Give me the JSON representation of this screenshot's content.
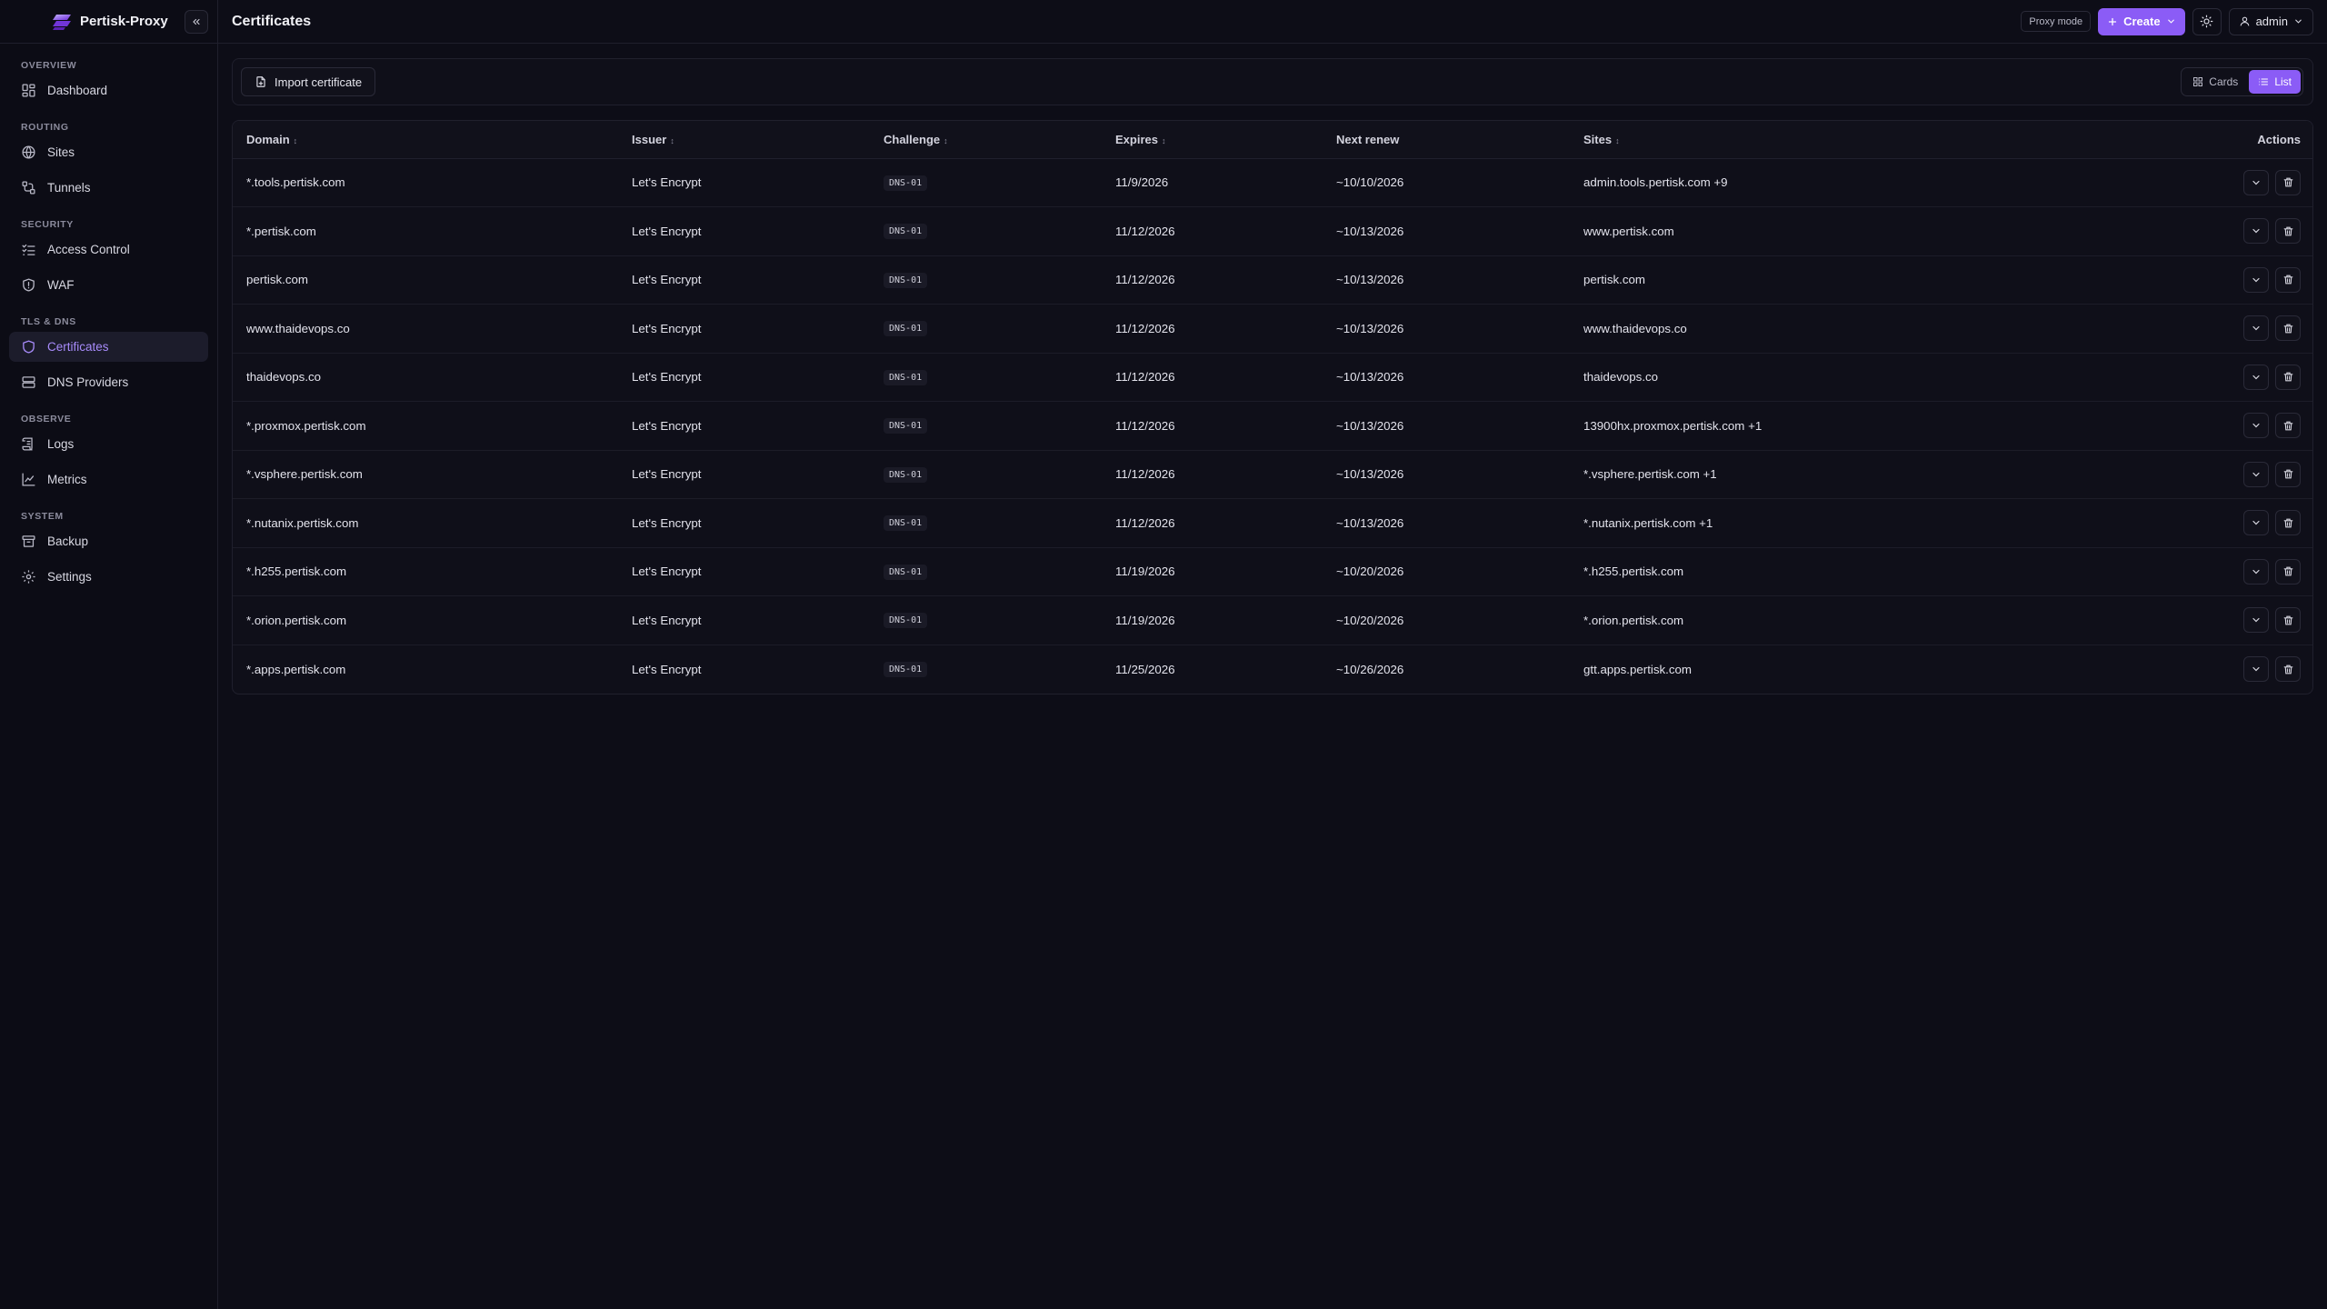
{
  "app": {
    "name": "Pertisk-Proxy"
  },
  "header": {
    "title": "Certificates",
    "proxy_mode": "Proxy mode",
    "create_label": "Create",
    "user": "admin"
  },
  "sidebar": {
    "sections": [
      {
        "title": "OVERVIEW",
        "items": [
          {
            "label": "Dashboard",
            "icon": "dashboard-icon"
          }
        ]
      },
      {
        "title": "ROUTING",
        "items": [
          {
            "label": "Sites",
            "icon": "globe-icon"
          },
          {
            "label": "Tunnels",
            "icon": "tunnel-icon"
          }
        ]
      },
      {
        "title": "SECURITY",
        "items": [
          {
            "label": "Access Control",
            "icon": "list-check-icon"
          },
          {
            "label": "WAF",
            "icon": "shield-alert-icon"
          }
        ]
      },
      {
        "title": "TLS & DNS",
        "items": [
          {
            "label": "Certificates",
            "icon": "shield-icon",
            "active": true
          },
          {
            "label": "DNS Providers",
            "icon": "server-icon"
          }
        ]
      },
      {
        "title": "OBSERVE",
        "items": [
          {
            "label": "Logs",
            "icon": "scroll-icon"
          },
          {
            "label": "Metrics",
            "icon": "chart-line-icon"
          }
        ]
      },
      {
        "title": "SYSTEM",
        "items": [
          {
            "label": "Backup",
            "icon": "archive-icon"
          },
          {
            "label": "Settings",
            "icon": "gear-icon"
          }
        ]
      }
    ]
  },
  "toolbar": {
    "import_label": "Import certificate",
    "view_cards": "Cards",
    "view_list": "List",
    "active_view": "List"
  },
  "table": {
    "columns": {
      "domain": "Domain",
      "issuer": "Issuer",
      "challenge": "Challenge",
      "expires": "Expires",
      "next_renew": "Next renew",
      "sites": "Sites",
      "actions": "Actions"
    },
    "rows": [
      {
        "domain": "*.tools.pertisk.com",
        "issuer": "Let's Encrypt",
        "challenge": "DNS-01",
        "expires": "11/9/2026",
        "next_renew": "~10/10/2026",
        "sites": "admin.tools.pertisk.com +9"
      },
      {
        "domain": "*.pertisk.com",
        "issuer": "Let's Encrypt",
        "challenge": "DNS-01",
        "expires": "11/12/2026",
        "next_renew": "~10/13/2026",
        "sites": "www.pertisk.com"
      },
      {
        "domain": "pertisk.com",
        "issuer": "Let's Encrypt",
        "challenge": "DNS-01",
        "expires": "11/12/2026",
        "next_renew": "~10/13/2026",
        "sites": "pertisk.com"
      },
      {
        "domain": "www.thaidevops.co",
        "issuer": "Let's Encrypt",
        "challenge": "DNS-01",
        "expires": "11/12/2026",
        "next_renew": "~10/13/2026",
        "sites": "www.thaidevops.co"
      },
      {
        "domain": "thaidevops.co",
        "issuer": "Let's Encrypt",
        "challenge": "DNS-01",
        "expires": "11/12/2026",
        "next_renew": "~10/13/2026",
        "sites": "thaidevops.co"
      },
      {
        "domain": "*.proxmox.pertisk.com",
        "issuer": "Let's Encrypt",
        "challenge": "DNS-01",
        "expires": "11/12/2026",
        "next_renew": "~10/13/2026",
        "sites": "13900hx.proxmox.pertisk.com +1"
      },
      {
        "domain": "*.vsphere.pertisk.com",
        "issuer": "Let's Encrypt",
        "challenge": "DNS-01",
        "expires": "11/12/2026",
        "next_renew": "~10/13/2026",
        "sites": "*.vsphere.pertisk.com +1"
      },
      {
        "domain": "*.nutanix.pertisk.com",
        "issuer": "Let's Encrypt",
        "challenge": "DNS-01",
        "expires": "11/12/2026",
        "next_renew": "~10/13/2026",
        "sites": "*.nutanix.pertisk.com +1"
      },
      {
        "domain": "*.h255.pertisk.com",
        "issuer": "Let's Encrypt",
        "challenge": "DNS-01",
        "expires": "11/19/2026",
        "next_renew": "~10/20/2026",
        "sites": "*.h255.pertisk.com"
      },
      {
        "domain": "*.orion.pertisk.com",
        "issuer": "Let's Encrypt",
        "challenge": "DNS-01",
        "expires": "11/19/2026",
        "next_renew": "~10/20/2026",
        "sites": "*.orion.pertisk.com"
      },
      {
        "domain": "*.apps.pertisk.com",
        "issuer": "Let's Encrypt",
        "challenge": "DNS-01",
        "expires": "11/25/2026",
        "next_renew": "~10/26/2026",
        "sites": "gtt.apps.pertisk.com"
      }
    ]
  },
  "colors": {
    "accent": "#8b5cf6",
    "active_text": "#a78bfa",
    "background": "#0d0d17"
  }
}
